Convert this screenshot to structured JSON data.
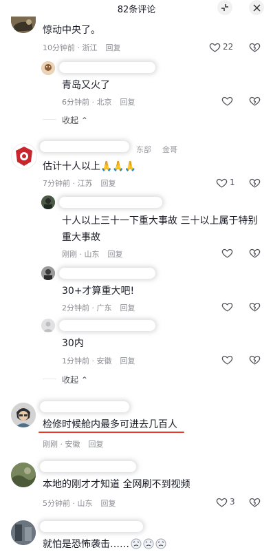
{
  "header": {
    "title": "82条评论",
    "collapse_icon": "collapse-icon",
    "close_icon": "close-icon"
  },
  "comments": [
    {
      "text": "惊动中央了。",
      "time": "10分钟前 · 浙江",
      "reply": "回复",
      "likes": "22",
      "replies": [
        {
          "text": "青岛又火了",
          "time": "6分钟前 · 北京",
          "reply": "回复"
        }
      ],
      "fold": "收起"
    },
    {
      "name_fragments": [
        "东部",
        "金哥"
      ],
      "text": "估计十人以上",
      "emoji": "🙏🙏🙏",
      "time": "7分钟前 · 江苏",
      "reply": "回复",
      "likes": "1",
      "replies": [
        {
          "text": "十人以上三十一下重大事故  三十以上属于特别重大事故",
          "time": "刚刚 · 山东",
          "reply": "回复"
        },
        {
          "text": "30+才算重大吧!",
          "time": "2分钟前 · 广东",
          "reply": "回复"
        },
        {
          "text": "30内",
          "time": "1分钟前 · 安徽",
          "reply": "回复"
        }
      ],
      "fold": "收起"
    },
    {
      "text": "检修时候舱内最多可进去几百人",
      "time": "刚刚 · 安徽",
      "reply": "回复"
    },
    {
      "text": "本地的刚才才知道  全网刷不到视频",
      "time": "5分钟前 · 山东",
      "reply": "回复",
      "likes": "3"
    },
    {
      "text": "就怕是恐怖袭击……"
    }
  ],
  "colors": {
    "underline": "#e33a2c",
    "meta": "#8a8b91",
    "text": "#161823"
  }
}
